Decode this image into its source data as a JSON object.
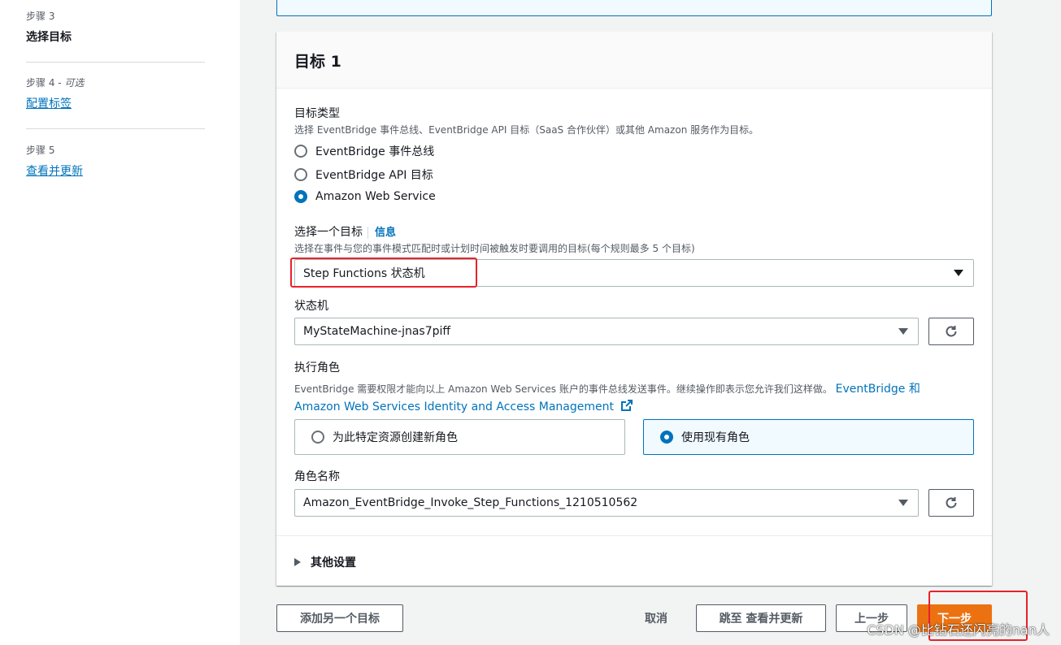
{
  "sidebar": {
    "steps": [
      {
        "label": "步骤 3",
        "title": "选择目标",
        "current": true
      },
      {
        "label": "步骤 4 - ",
        "optional": "可选",
        "title": "配置标签"
      },
      {
        "label": "步骤 5",
        "title": "查看并更新"
      }
    ]
  },
  "card": {
    "title": "目标 1",
    "target_type": {
      "label": "目标类型",
      "description": "选择 EventBridge 事件总线、EventBridge API 目标（SaaS 合作伙伴）或其他 Amazon 服务作为目标。",
      "options": [
        "EventBridge 事件总线",
        "EventBridge API 目标",
        "Amazon Web Service"
      ],
      "selected_index": 2
    },
    "select_target": {
      "label": "选择一个目标",
      "info": "信息",
      "description": "选择在事件与您的事件模式匹配时或计划时间被触发时要调用的目标(每个规则最多 5 个目标)",
      "value": "Step Functions 状态机"
    },
    "state_machine": {
      "label": "状态机",
      "value": "MyStateMachine-jnas7piff"
    },
    "execution_role": {
      "label": "执行角色",
      "description": "EventBridge 需要权限才能向以上 Amazon Web Services 账户的事件总线发送事件。继续操作即表示您允许我们这样做。",
      "link_part1": "EventBridge 和",
      "link_part2": "Amazon Web Services Identity and Access Management",
      "options": [
        "为此特定资源创建新角色",
        "使用现有角色"
      ],
      "selected_index": 1
    },
    "role_name": {
      "label": "角色名称",
      "value": "Amazon_EventBridge_Invoke_Step_Functions_1210510562"
    },
    "additional_settings": "其他设置"
  },
  "footer": {
    "add_target": "添加另一个目标",
    "cancel": "取消",
    "skip_review": "跳至 查看并更新",
    "previous": "上一步",
    "next": "下一步"
  },
  "watermark": "CSDN @比钻石还闪亮的nan人",
  "colors": {
    "accent": "#0073bb",
    "primary_button": "#ec7211",
    "highlight_box": "#e8212b"
  }
}
